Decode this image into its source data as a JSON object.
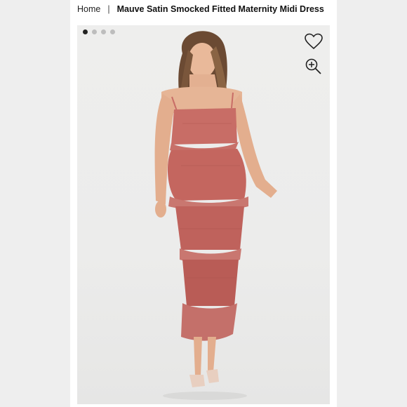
{
  "breadcrumb": {
    "home": "Home",
    "separator": "|",
    "current": "Mauve Satin Smocked Fitted Maternity Midi Dress"
  },
  "gallery": {
    "total_images": 4,
    "active_index": 0
  },
  "icons": {
    "favorite": "heart-icon",
    "zoom": "zoom-in-icon"
  },
  "colors": {
    "dress": "#c86d66",
    "dress_shadow": "#a9514d",
    "skin": "#e9b99a",
    "hair": "#6b4a33",
    "shoes": "#e8cfc0"
  }
}
